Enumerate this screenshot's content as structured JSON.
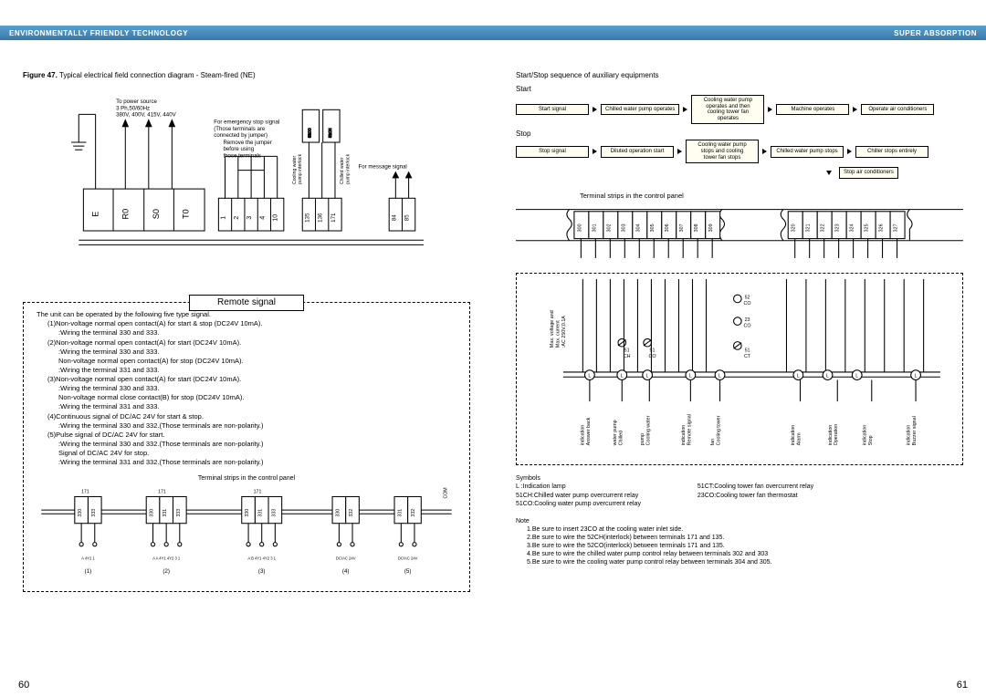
{
  "header": {
    "left": "ENVIRONMENTALLY FRIENDLY TECHNOLOGY",
    "right": "SUPER ABSORPTION"
  },
  "figure": {
    "number": "Figure 47.",
    "caption": "Typical electrical field connection diagram - Steam-fired (NE)"
  },
  "power_source_note": {
    "line1": "To power source",
    "line2": "3 Ph,50/60Hz",
    "line3": "380V, 400V, 415V, 440V"
  },
  "emergency_note": {
    "line1": "For emergency stop signal",
    "line2": "(Those terminals are",
    "line3": "connected by jumper)",
    "line4": "Remove the jumper",
    "line5": "before using",
    "line6": "those terminals"
  },
  "message_signal_note": "For message signal",
  "main_terminals": {
    "big": [
      "E",
      "R0",
      "S0",
      "T0"
    ],
    "small1": [
      "1",
      "2",
      "3",
      "4",
      "10"
    ],
    "small2": [
      "135",
      "136",
      "171"
    ],
    "small3": [
      "84",
      "85"
    ]
  },
  "vertical_labels": {
    "cooling_interlock": "Cooling water\npump interlock",
    "chilled_interlock": "Chilled water\npump interlock"
  },
  "remote": {
    "title": "Remote signal",
    "intro": "The unit can be operated by the following five type signal.",
    "lines": [
      {
        "i": 0,
        "t": "(1)Non-voltage normal open contact(A) for start & stop (DC24V 10mA)."
      },
      {
        "i": 1,
        "t": ":Wiring the terminal 330 and 333."
      },
      {
        "i": 0,
        "t": "(2)Non-voltage normal open contact(A) for start (DC24V 10mA)."
      },
      {
        "i": 1,
        "t": ":Wiring the terminal 330 and 333."
      },
      {
        "i": 1,
        "t": "Non-voltage normal open contact(A) for stop (DC24V 10mA)."
      },
      {
        "i": 1,
        "t": ":Wiring the terminal 331 and 333."
      },
      {
        "i": 0,
        "t": "(3)Non-voltage normal open contact(A) for start (DC24V 10mA)."
      },
      {
        "i": 1,
        "t": ":Wiring the terminal 330 and 333."
      },
      {
        "i": 1,
        "t": "Non-voltage normal close contact(B) for stop (DC24V 10mA)."
      },
      {
        "i": 1,
        "t": ":Wiring the terminal 331 and 333."
      },
      {
        "i": 0,
        "t": "(4)Continuous signal of DC/AC 24V for start & stop."
      },
      {
        "i": 1,
        "t": ":Wiring the terminal 330 and 332.(Those terminals are non-polarity.)"
      },
      {
        "i": 0,
        "t": "(5)Pulse signal of DC/AC 24V for start."
      },
      {
        "i": 1,
        "t": ":Wiring the terminal 330 and 332.(Those terminals are non-polarity.)"
      },
      {
        "i": 1,
        "t": "Signal of DC/AC 24V for stop."
      },
      {
        "i": 1,
        "t": ":Wiring the terminal 331 and 332.(Those terminals are non-polarity.)"
      }
    ],
    "terminal_caption": "Terminal strips in the control panel",
    "groups": [
      {
        "top": "171",
        "cells": [
          "330",
          "333"
        ],
        "sub": [
          "A",
          "4Y2",
          "1"
        ],
        "label": "(1)"
      },
      {
        "top": "171",
        "cells": [
          "330",
          "331",
          "333"
        ],
        "sub": [
          "A",
          "A",
          "4Y1",
          "4Y2",
          "3",
          "1"
        ],
        "label": "(2)"
      },
      {
        "top": "171",
        "cells": [
          "330",
          "331",
          "333"
        ],
        "sub": [
          "A",
          "B",
          "4Y1",
          "4Y2",
          "3",
          "1"
        ],
        "label": "(3)"
      },
      {
        "top": "",
        "cells": [
          "330",
          "332"
        ],
        "sub": [
          "DC/AC 24V"
        ],
        "label": "(4)"
      },
      {
        "top": "",
        "cells": [
          "331",
          "332"
        ],
        "sub": [
          "DC/AC 24V"
        ],
        "label": "(5)"
      }
    ],
    "com_label": "COM"
  },
  "seq": {
    "title": "Start/Stop sequence of auxiliary equipments",
    "start_label": "Start",
    "start_flow": [
      "Start signal",
      "Chilled water pump operates",
      "Cooling water pump\noperates and then\ncooling tower fan\noperates",
      "Machine operates",
      "Operate air conditioners"
    ],
    "stop_label": "Stop",
    "stop_flow": [
      "Stop signal",
      "Diluted operation start",
      "Cooling water pump\nstops and cooling\ntower fan stops",
      "Chilled water pump stops",
      "Chiller stops entirely"
    ],
    "stop_extra": "Stop air conditioners"
  },
  "right_terminals": {
    "caption": "Terminal strips in the control panel",
    "group_a": [
      "300",
      "301",
      "302",
      "303",
      "304",
      "305",
      "306",
      "307",
      "308",
      "309"
    ],
    "group_b": [
      "320",
      "321",
      "322",
      "323",
      "324",
      "325",
      "326",
      "327"
    ]
  },
  "right_diagram": {
    "max_line1": "Max. voltage and",
    "max_line2": "Max. current",
    "max_line3": ":AC 250V,0.1A",
    "relays": [
      "51\nCH",
      "51\nCO",
      "52\nCO",
      "23\nCO",
      "51\nCT"
    ],
    "bottom_labels": [
      "Answer back\nindication",
      "Chilled\nwater pump",
      "Cooling water\npump",
      "Remote signal\nindication",
      "Cooling tower\nfan",
      "Alarm\nindication",
      "Operation\nindication",
      "Stop\nindication",
      "Buzzer signal\nindication"
    ]
  },
  "symbols": {
    "heading": "Symbols",
    "left": [
      "L :Indication lamp",
      "51CH:Chilled water pump overcurrent relay",
      "51CO:Cooling water pump overcurrent relay"
    ],
    "right": [
      "51CT:Cooling tower fan overcurrent relay",
      "23CO:Cooling tower fan thermostat"
    ]
  },
  "notes": {
    "heading": "Note",
    "lines": [
      "1.Be sure to insert 23CO  at the cooling water inlet side.",
      "2.Be sure to wire the 52CH(interlock) between terminals 171 and 135.",
      "3.Be sure to wire the 52CO(interlock) between terminals 171 and 135.",
      "4.Be sure to wire the chilled water pump control relay between terminals 302 and 303",
      "5.Be sure to wire the cooling water pump control relay between terminals 304 and 305."
    ]
  },
  "pages": {
    "left": "60",
    "right": "61"
  }
}
